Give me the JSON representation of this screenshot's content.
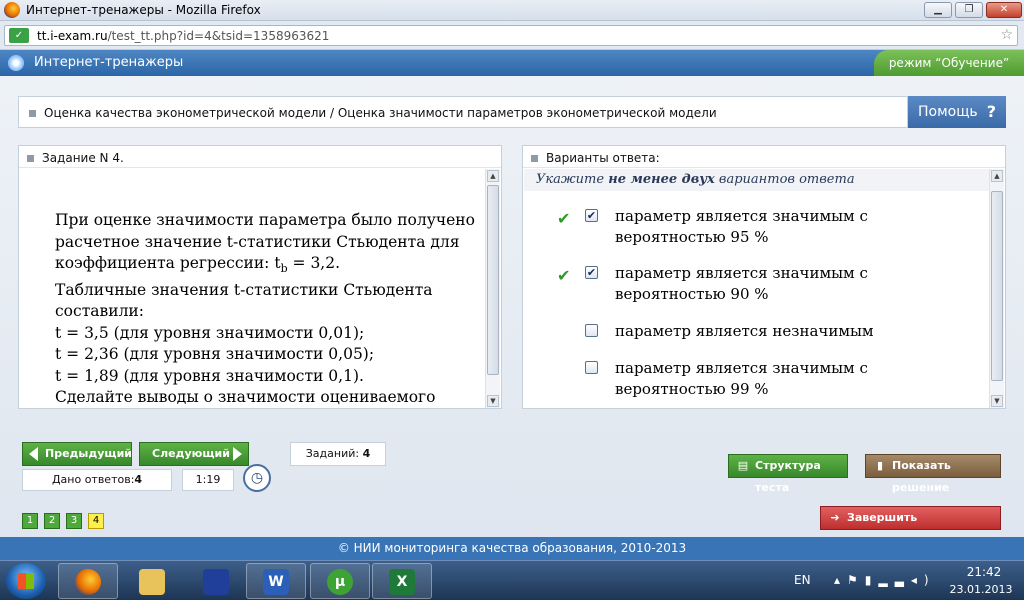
{
  "window": {
    "title": "Интернет-тренажеры - Mozilla Firefox",
    "minimize": "▁",
    "maximize": "❐",
    "close": "✕"
  },
  "address": {
    "url_domain": "tt.i-exam.ru",
    "url_path": "/test_tt.php?id=4&tsid=1358963621",
    "star": "☆"
  },
  "app": {
    "name": "Интернет-тренажеры",
    "mode": "режим “Обучение”"
  },
  "topic": {
    "text": "Оценка качества эконометрической модели / Оценка значимости параметров эконометрической модели",
    "help_label": "Помощь",
    "help_icon": "?"
  },
  "task": {
    "header": "Задание N 4.",
    "lines": [
      "При оценке значимости параметра было получено",
      "расчетное значение t-статистики Стьюдента для",
      "коэффициента регрессии: t",
      "b",
      " = 3,2.",
      "Табличные значения t-статистики Стьюдента",
      "составили:",
      "t = 3,5 (для уровня значимости 0,01);",
      "t = 2,36 (для уровня значимости 0,05);",
      "t = 1,89 (для уровня значимости 0,1).",
      "Сделайте выводы о значимости оцениваемого"
    ]
  },
  "answers": {
    "header": "Варианты ответа:",
    "hint_pre": "Укажите ",
    "hint_bold": "не менее двух",
    "hint_post": " вариантов ответа",
    "options": [
      {
        "label": "параметр является значимым с вероятностью 95 %",
        "checked": true,
        "correct_mark": "✔",
        "box": "✔"
      },
      {
        "label": "параметр является значимым с вероятностью 90 %",
        "checked": true,
        "correct_mark": "✔",
        "box": "✔"
      },
      {
        "label": "параметр является незначимым",
        "checked": false,
        "correct_mark": "",
        "box": ""
      },
      {
        "label": "параметр является значимым с вероятностью 99 %",
        "checked": false,
        "correct_mark": "",
        "box": ""
      }
    ]
  },
  "controls": {
    "prev": "Предыдущий",
    "next": "Следующий",
    "tasks_label": "Заданий:",
    "tasks_count": "4",
    "answered_label": "Дано ответов:",
    "answered_count": "4",
    "timer": "1:19",
    "pages": [
      "1",
      "2",
      "3",
      "4"
    ],
    "current_page": "4",
    "structure": "Структура теста",
    "show_solution": "Показать решение",
    "finish": "Завершить тестирование"
  },
  "footer": {
    "text": "© НИИ мониторинга качества образования, 2010-2013"
  },
  "taskbar": {
    "lang": "EN",
    "time": "21:42",
    "date": "23.01.2013",
    "apps": [
      "firefox-app",
      "explorer-app",
      "save-app",
      "word-app",
      "utorrent-app",
      "excel-app"
    ],
    "word_glyph": "W",
    "utorrent_glyph": "µ",
    "excel_glyph": "X"
  },
  "colors": {
    "header_blue": "#2d66a8",
    "mode_green": "#4f9b31",
    "nav_green": "#37882a",
    "finish_red": "#bd2f2f",
    "current_page_yellow": "#ffef4a"
  }
}
